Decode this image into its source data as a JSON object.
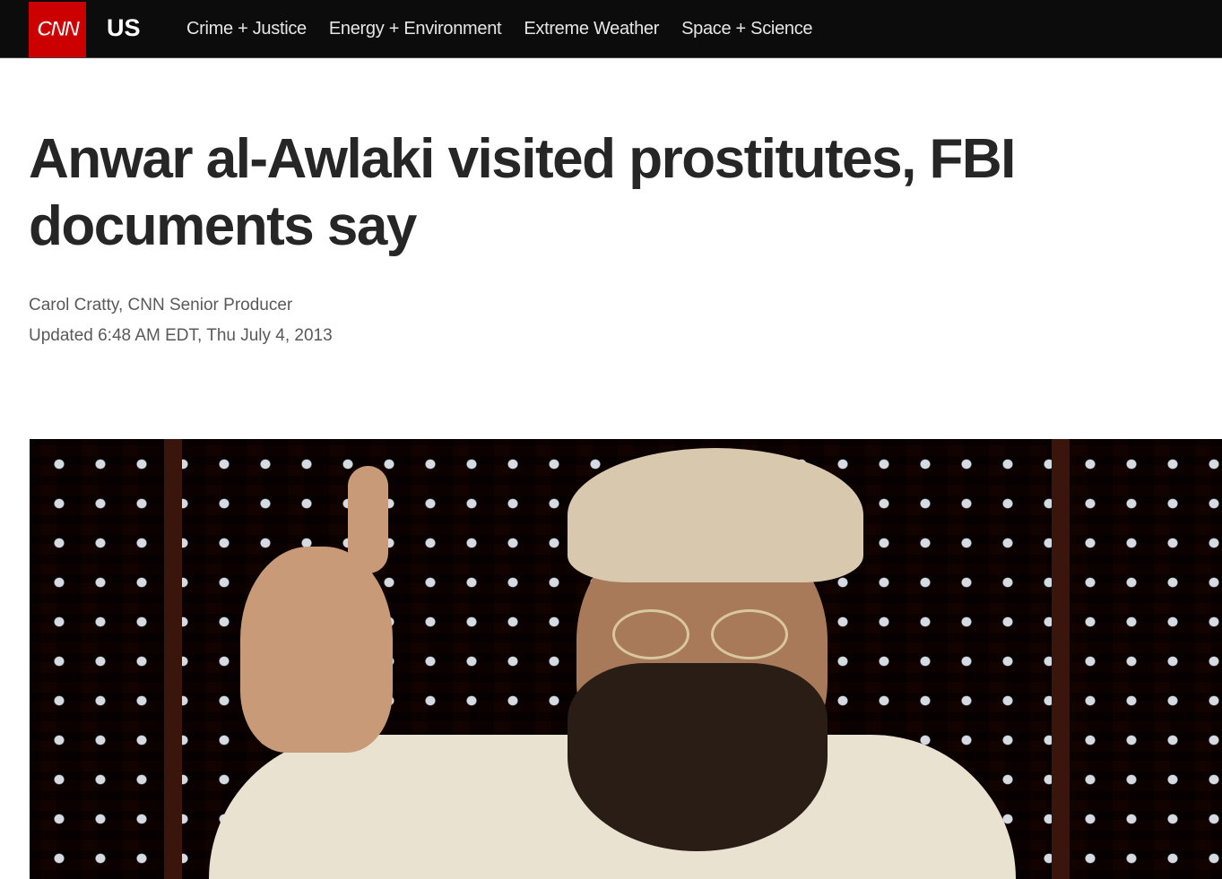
{
  "nav": {
    "logo": "CNN",
    "section": "US",
    "links": [
      "Crime + Justice",
      "Energy + Environment",
      "Extreme Weather",
      "Space + Science"
    ]
  },
  "article": {
    "headline": "Anwar al-Awlaki visited prostitutes, FBI documents say",
    "byline": "Carol Cratty, CNN Senior Producer",
    "updated": "Updated 6:48 AM EDT, Thu July 4, 2013"
  },
  "colors": {
    "brand": "#cc0000",
    "nav_bg": "#0c0c0c",
    "headline": "#262626"
  }
}
